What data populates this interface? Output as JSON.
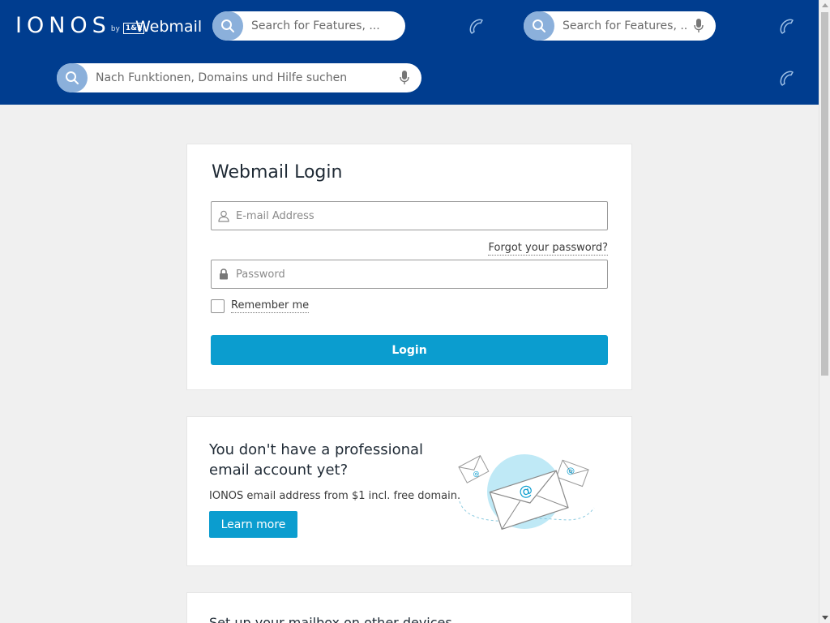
{
  "header": {
    "logo_text": "IONOS",
    "logo_by": "by",
    "logo_brand": "1&1",
    "app_title": "Webmail",
    "search_top_left": {
      "placeholder": "Search for Features, ..."
    },
    "search_top_right": {
      "placeholder": "Search for Features, ..."
    },
    "search_main": {
      "placeholder": "Nach Funktionen, Domains und Hilfe suchen"
    }
  },
  "login": {
    "title": "Webmail Login",
    "email_placeholder": "E-mail Address",
    "forgot_link": "Forgot your password?",
    "password_placeholder": "Password",
    "remember_label": "Remember me",
    "remember_checked": false,
    "login_button": "Login"
  },
  "promo": {
    "title": "You don't have a professional email account yet?",
    "subtitle": "IONOS email address from $1 incl. free domain.",
    "button": "Learn more"
  },
  "setup": {
    "title": "Set up your mailbox on other devices"
  },
  "colors": {
    "header_bg": "#003d8f",
    "accent": "#0b9dcf",
    "search_btn": "#8bb0db",
    "page_bg": "#f0f0f0"
  },
  "icons": [
    "search-icon",
    "microphone-icon",
    "phone-icon",
    "user-icon",
    "lock-icon",
    "envelope-illustration"
  ]
}
